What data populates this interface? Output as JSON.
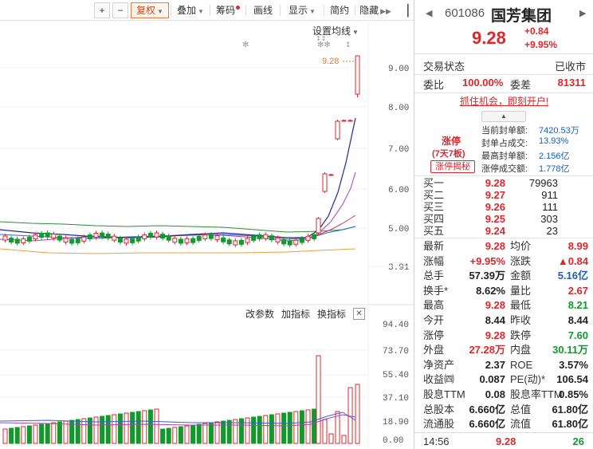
{
  "toolbar": {
    "plus": "+",
    "minus": "−",
    "fuquan": "复权",
    "diejia": "叠加",
    "chouma": "筹码",
    "huaxian": "画线",
    "xianshi": "显示",
    "jianyue": "简约",
    "yincang": "隐藏"
  },
  "chart": {
    "set_ma": "设置均线",
    "price_label": "9.28",
    "y_labels": [
      "9.00",
      "8.00",
      "7.00",
      "6.00",
      "5.00",
      "3.91"
    ],
    "ind_buttons": {
      "change_params": "改参数",
      "add_indicator": "加指标",
      "switch_indicator": "换指标"
    },
    "vol_labels": [
      "94.40",
      "73.70",
      "55.40",
      "37.10",
      "18.90",
      "0.00"
    ]
  },
  "quote": {
    "code": "601086",
    "name": "国芳集团",
    "price": "9.28",
    "change": "+0.84",
    "change_pct": "+9.95%",
    "trade_status_label": "交易状态",
    "trade_status": "已收市",
    "weibi_label": "委比",
    "weibi": "100.00%",
    "weicha_label": "委差",
    "weicha": "81311",
    "open_account": "抓住机会，即刻开户!",
    "limit": {
      "title": "涨停",
      "sub": "(7天7板)",
      "reveal": "涨停揭秘",
      "items": [
        {
          "k": "当前封单额:",
          "v": "7420.53万"
        },
        {
          "k": "封单占成交:",
          "v": "13.93%"
        },
        {
          "k": "最高封单额:",
          "v": "2.156亿"
        },
        {
          "k": "涨停成交额:",
          "v": "1.778亿"
        }
      ]
    },
    "orderbook": [
      {
        "label": "买一",
        "price": "9.28",
        "vol": "79963"
      },
      {
        "label": "买二",
        "price": "9.27",
        "vol": "911"
      },
      {
        "label": "买三",
        "price": "9.26",
        "vol": "111"
      },
      {
        "label": "买四",
        "price": "9.25",
        "vol": "303"
      },
      {
        "label": "买五",
        "price": "9.24",
        "vol": "23"
      }
    ],
    "stats": [
      {
        "k1": "最新",
        "v1": "9.28",
        "c1": "red",
        "k2": "均价",
        "v2": "8.99",
        "c2": "red"
      },
      {
        "k1": "涨幅",
        "v1": "+9.95%",
        "c1": "red",
        "k2": "涨跌",
        "v2": "▲0.84",
        "c2": "red"
      },
      {
        "k1": "总手",
        "v1": "57.39万",
        "c1": "dark",
        "k2": "金额",
        "v2": "5.16亿",
        "c2": "blue"
      },
      {
        "k1": "换手*",
        "v1": "8.62%",
        "c1": "dark",
        "k2": "量比",
        "v2": "2.67",
        "c2": "red"
      },
      {
        "k1": "最高",
        "v1": "9.28",
        "c1": "red",
        "k2": "最低",
        "v2": "8.21",
        "c2": "green"
      },
      {
        "k1": "今开",
        "v1": "8.44",
        "c1": "dark",
        "k2": "昨收",
        "v2": "8.44",
        "c2": "dark"
      },
      {
        "k1": "涨停",
        "v1": "9.28",
        "c1": "red",
        "k2": "跌停",
        "v2": "7.60",
        "c2": "green"
      },
      {
        "k1": "外盘",
        "v1": "27.28万",
        "c1": "red",
        "k2": "内盘",
        "v2": "30.11万",
        "c2": "green"
      },
      {
        "k1": "净资产",
        "v1": "2.37",
        "c1": "dark",
        "k2": "ROE",
        "v2": "3.57%",
        "c2": "dark"
      },
      {
        "k1": "收益㈣",
        "v1": "0.087",
        "c1": "dark",
        "k2": "PE(动)*",
        "v2": "106.54",
        "c2": "dark"
      },
      {
        "k1": "股息TTM",
        "v1": "0.08",
        "c1": "dark",
        "k2": "股息率TTM",
        "v2": "0.85%",
        "c2": "dark"
      },
      {
        "k1": "总股本",
        "v1": "6.660亿",
        "c1": "dark",
        "k2": "总值",
        "v2": "61.80亿",
        "c2": "dark"
      },
      {
        "k1": "流通股",
        "v1": "6.660亿",
        "c1": "dark",
        "k2": "流值",
        "v2": "61.80亿",
        "c2": "dark"
      }
    ],
    "tick": {
      "time": "14:56",
      "price": "9.28",
      "vol": "26"
    }
  },
  "colors": {
    "up": "#e0262b",
    "down": "#119a2c",
    "accent": "#e07b39",
    "blue": "#1c5fb8"
  }
}
